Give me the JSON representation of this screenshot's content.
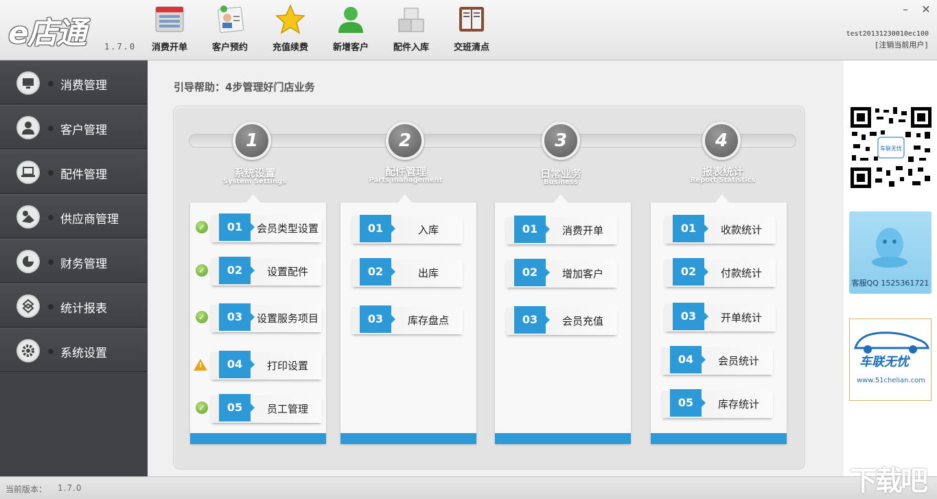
{
  "app": {
    "logo": "e店通",
    "version": "1.7.0"
  },
  "toolbar": {
    "items": [
      {
        "label": "消费开单",
        "icon": "document-list-icon"
      },
      {
        "label": "客户预约",
        "icon": "contact-card-icon"
      },
      {
        "label": "充值续费",
        "icon": "star-icon"
      },
      {
        "label": "新增客户",
        "icon": "add-user-icon"
      },
      {
        "label": "配件入库",
        "icon": "boxes-icon"
      },
      {
        "label": "交班清点",
        "icon": "ledger-icon"
      }
    ]
  },
  "window": {
    "minimize": "–",
    "close": "✕"
  },
  "user": {
    "account": "test20131230010ec100",
    "logout": "[注销当前用户]"
  },
  "sidebar": {
    "items": [
      {
        "label": "消费管理",
        "icon": "monitor-icon"
      },
      {
        "label": "客户管理",
        "icon": "user-icon"
      },
      {
        "label": "配件管理",
        "icon": "laptop-icon"
      },
      {
        "label": "供应商管理",
        "icon": "supplier-icon"
      },
      {
        "label": "财务管理",
        "icon": "pie-chart-icon"
      },
      {
        "label": "统计报表",
        "icon": "report-icon"
      },
      {
        "label": "系统设置",
        "icon": "gear-icon"
      }
    ]
  },
  "guide": {
    "title": "引导帮助：4步管理好门店业务",
    "steps": [
      {
        "num": "1",
        "title": "系统设置",
        "subtitle": "System Settings",
        "rows": [
          {
            "num": "01",
            "label": "会员类型设置",
            "status": "done"
          },
          {
            "num": "02",
            "label": "设置配件",
            "status": "done"
          },
          {
            "num": "03",
            "label": "设置服务项目",
            "status": "done"
          },
          {
            "num": "04",
            "label": "打印设置",
            "status": "warning"
          },
          {
            "num": "05",
            "label": "员工管理",
            "status": "done"
          }
        ]
      },
      {
        "num": "2",
        "title": "配件管理",
        "subtitle": "Parts management",
        "rows": [
          {
            "num": "01",
            "label": "入库"
          },
          {
            "num": "02",
            "label": "出库"
          },
          {
            "num": "03",
            "label": "库存盘点"
          }
        ]
      },
      {
        "num": "3",
        "title": "日常业务",
        "subtitle": "Business",
        "rows": [
          {
            "num": "01",
            "label": "消费开单"
          },
          {
            "num": "02",
            "label": "增加客户"
          },
          {
            "num": "03",
            "label": "会员充值"
          }
        ]
      },
      {
        "num": "4",
        "title": "报表统计",
        "subtitle": "Report Statistics",
        "rows": [
          {
            "num": "01",
            "label": "收款统计"
          },
          {
            "num": "02",
            "label": "付款统计"
          },
          {
            "num": "03",
            "label": "开单统计"
          },
          {
            "num": "04",
            "label": "会员统计"
          },
          {
            "num": "05",
            "label": "库存统计"
          }
        ]
      }
    ]
  },
  "right_panel": {
    "qr_badge": "车联无忧",
    "qq_text": "客服QQ 1525361721",
    "ad_title": "车联无忧",
    "ad_url": "www.51chelian.com"
  },
  "status": {
    "label": "当前版本：",
    "version": "1.7.0"
  },
  "watermark": "下载吧",
  "colors": {
    "accent": "#2d9ad7",
    "sidebar": "#404245",
    "check": "#5aa12a",
    "warning": "#e8a51c"
  }
}
